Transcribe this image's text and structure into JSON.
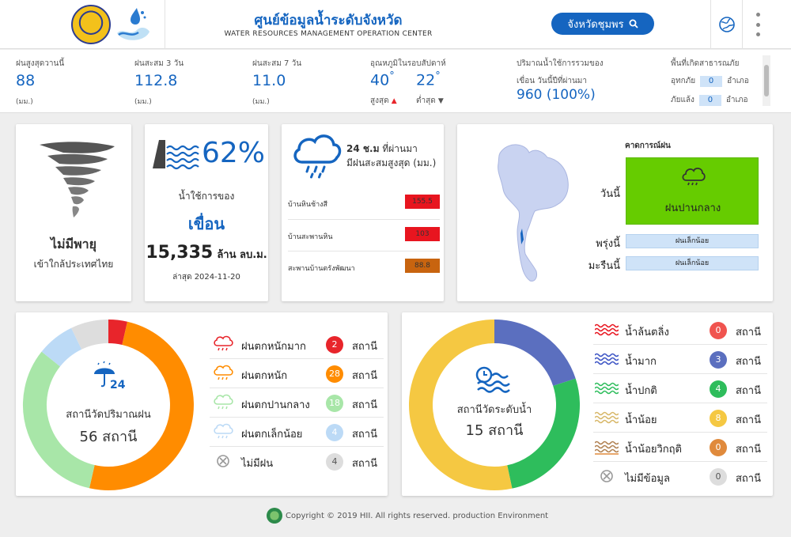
{
  "header": {
    "title_th": "ศูนย์ข้อมูลน้ำระดับจังหวัด",
    "title_en": "WATER RESOURCES MANAGEMENT OPERATION CENTER",
    "province_button": "จังหวัดชุมพร",
    "logo1_icon": "provincial-seal-icon",
    "logo2_icon": "water-drop-logo-icon"
  },
  "stats": {
    "rain_today": {
      "label": "ฝนสูงสุดวานนี้",
      "value": "88",
      "unit": "(มม.)"
    },
    "rain_3day": {
      "label": "ฝนสะสม 3 วัน",
      "value": "112.8",
      "unit": "(มม.)"
    },
    "rain_7day": {
      "label": "ฝนสะสม 7 วัน",
      "value": "11.0",
      "unit": "(มม.)"
    },
    "temperature": {
      "label": "อุณหภูมิในรอบสัปดาห์",
      "max_value": "40",
      "max_label": "สูงสุด",
      "min_value": "22",
      "min_label": "ต่ำสุด",
      "degree": "°"
    },
    "dam_volume": {
      "label1": "ปริมาณน้ำใช้การรวมของ",
      "label2": "เขื่อน วันนี้ปีที่ผ่านมา",
      "value": "960 (100%)"
    },
    "disaster": {
      "label": "พื้นที่เกิดสาธารณภัย",
      "flood_label": "อุทกภัย",
      "flood_value": "0",
      "drought_label": "ภัยแล้ง",
      "drought_value": "0",
      "unit": "อำเภอ"
    }
  },
  "storm": {
    "title": "ไม่มีพายุ",
    "subtitle": "เข้าใกล้ประเทศไทย"
  },
  "dam": {
    "percent": "62%",
    "line1": "น้ำใช้การของ",
    "line2": "เขื่อน",
    "volume": "15,335",
    "volume_unit": "ล้าน ลบ.ม.",
    "date": "ล่าสุด 2024-11-20"
  },
  "rain24": {
    "heading_bold": "24 ช.ม",
    "heading_rest": " ที่ผ่านมา",
    "heading2": "มีฝนสะสมสูงสุด (มม.)",
    "rows": [
      {
        "name": "บ้านหินช้างสี",
        "value": "155.5",
        "color": "#e8151f"
      },
      {
        "name": "บ้านสะพานหิน",
        "value": "103",
        "color": "#e8151f"
      },
      {
        "name": "สะพานบ้านตรังพัฒนา",
        "value": "88.8",
        "color": "#c8640f"
      }
    ]
  },
  "forecast": {
    "title": "คาดการณ์ฝน",
    "today_label": "วันนี้",
    "today_value": "ฝนปานกลาง",
    "tomorrow_label": "พรุ่งนี้",
    "tomorrow_value": "ฝนเล็กน้อย",
    "dayafter_label": "มะรืนนี้",
    "dayafter_value": "ฝนเล็กน้อย"
  },
  "rain_stations": {
    "center_label": "สถานีวัดปริมาณฝน",
    "center_value": "56 สถานี",
    "unit": "สถานี",
    "items": [
      {
        "label": "ฝนตกหนักมาก",
        "count": "2",
        "color": "#e8252b",
        "icon": "cloud-heavy-rain-icon"
      },
      {
        "label": "ฝนตกหนัก",
        "count": "28",
        "color": "#ff8c00",
        "icon": "cloud-rain-icon"
      },
      {
        "label": "ฝนตกปานกลาง",
        "count": "18",
        "color": "#a8e6a8",
        "icon": "cloud-moderate-rain-icon"
      },
      {
        "label": "ฝนตกเล็กน้อย",
        "count": "4",
        "color": "#bcdaf6",
        "icon": "cloud-light-rain-icon"
      },
      {
        "label": "ไม่มีฝน",
        "count": "4",
        "color": "#dddddd",
        "icon": "no-rain-icon"
      }
    ]
  },
  "water_stations": {
    "center_label": "สถานีวัดระดับน้ำ",
    "center_value": "15 สถานี",
    "unit": "สถานี",
    "items": [
      {
        "label": "น้ำล้นตลิ่ง",
        "count": "0",
        "color": "#f0544f",
        "wave": "#e8151f",
        "icon": "water-overflow-icon"
      },
      {
        "label": "น้ำมาก",
        "count": "3",
        "color": "#5b6fbf",
        "wave": "#3a52c4",
        "icon": "water-high-icon"
      },
      {
        "label": "น้ำปกติ",
        "count": "4",
        "color": "#2ebd5c",
        "wave": "#2ebd5c",
        "icon": "water-normal-icon"
      },
      {
        "label": "น้ำน้อย",
        "count": "8",
        "color": "#f5c842",
        "wave": "#d8b86a",
        "icon": "water-low-icon"
      },
      {
        "label": "น้ำน้อยวิกฤติ",
        "count": "0",
        "color": "#e08a3c",
        "wave": "#b08050",
        "icon": "water-critical-icon"
      },
      {
        "label": "ไม่มีข้อมูล",
        "count": "0",
        "color": "#dddddd",
        "wave": "#999999",
        "icon": "no-data-icon"
      }
    ]
  },
  "footer": {
    "text": "Copyright © 2019 HII. All rights reserved. production Environment"
  }
}
